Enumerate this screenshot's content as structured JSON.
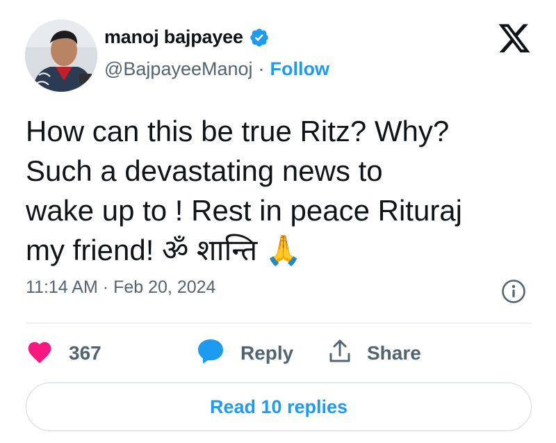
{
  "author": {
    "name": "manoj bajpayee",
    "handle": "@BajpayeeManoj",
    "separator": "·",
    "follow_label": "Follow",
    "verified": true
  },
  "tweet": {
    "lines": [
      "How can this be true Ritz? Why?",
      "Such a devastating news to",
      "wake up to ! Rest in peace Rituraj",
      "my friend! ॐ शान्ति 🙏"
    ],
    "time": "11:14 AM",
    "separator": "·",
    "date": "Feb 20, 2024"
  },
  "actions": {
    "like_count": "367",
    "reply_label": "Reply",
    "share_label": "Share"
  },
  "read_replies_label": "Read 10 replies",
  "colors": {
    "accent": "#1d9bf0",
    "like": "#f91880",
    "text": "#0f1419",
    "muted": "#536471"
  },
  "icons": [
    "verified-badge-icon",
    "x-logo-icon",
    "info-icon",
    "heart-icon",
    "reply-bubble-icon",
    "share-icon"
  ]
}
